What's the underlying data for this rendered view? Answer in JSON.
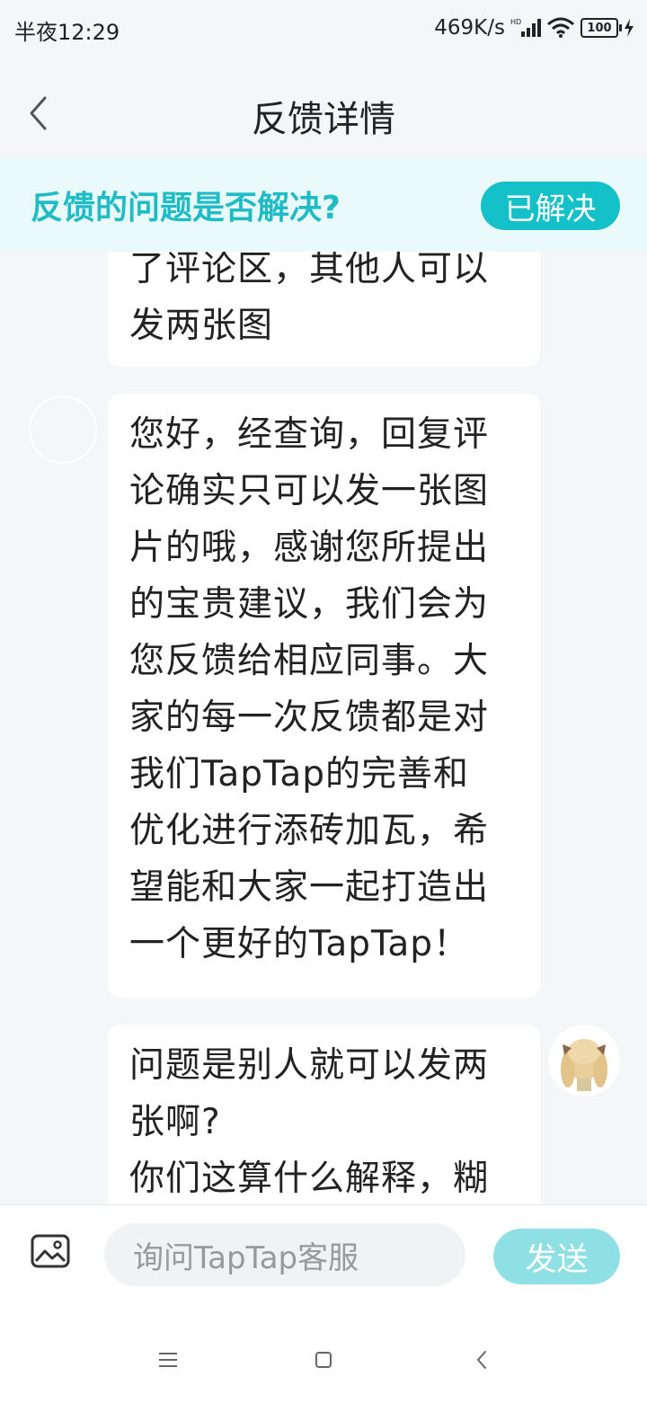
{
  "status_bar": {
    "time": "半夜12:29",
    "net_speed": "469K/s",
    "battery": "100"
  },
  "header": {
    "title": "反馈详情",
    "back_icon": "chevron-left-icon"
  },
  "resolve_prompt": {
    "question": "反馈的问题是否解决?",
    "button_label": "已解决",
    "accent": "#15c1c9"
  },
  "messages": [
    {
      "sender": "user",
      "lines": [
        "了评论区，其他人可以",
        "发两张图"
      ]
    },
    {
      "sender": "support",
      "lines": [
        "您好，经查询，回复评",
        "论确实只可以发一张图",
        "片的哦，感谢您所提出",
        "的宝贵建议，我们会为",
        "您反馈给相应同事。大",
        "家的每一次反馈都是对",
        "我们TapTap的完善和",
        "优化进行添砖加瓦，希",
        "望能和大家一起打造出",
        "一个更好的TapTap！"
      ]
    },
    {
      "sender": "user",
      "lines": [
        "问题是别人就可以发两",
        "张啊?",
        "你们这算什么解释，糊"
      ]
    }
  ],
  "composer": {
    "placeholder": "询问TapTap客服",
    "send_label": "发送",
    "image_icon": "image-icon"
  }
}
